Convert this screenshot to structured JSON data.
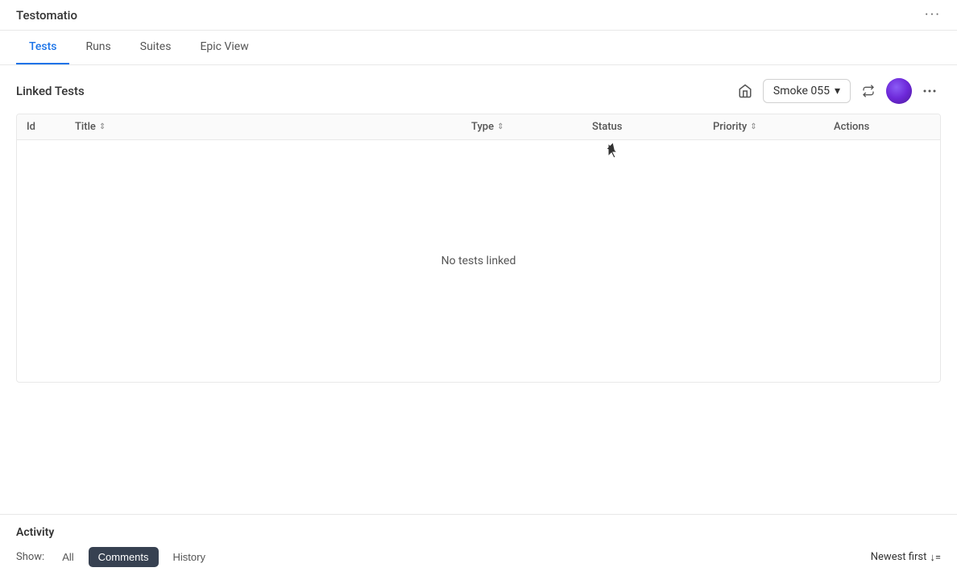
{
  "app": {
    "title": "Testomatio",
    "more_dots": "···"
  },
  "nav": {
    "tabs": [
      {
        "id": "tests",
        "label": "Tests",
        "active": true
      },
      {
        "id": "runs",
        "label": "Runs",
        "active": false
      },
      {
        "id": "suites",
        "label": "Suites",
        "active": false
      },
      {
        "id": "epic-view",
        "label": "Epic View",
        "active": false
      }
    ]
  },
  "content": {
    "title": "Linked Tests",
    "suite_selector": {
      "value": "Smoke 055",
      "chevron": "▾"
    },
    "empty_message": "No tests linked"
  },
  "table": {
    "columns": [
      {
        "id": "id",
        "label": "Id",
        "sortable": false
      },
      {
        "id": "title",
        "label": "Title",
        "sort_icon": "⇕"
      },
      {
        "id": "type",
        "label": "Type",
        "sort_icon": "⇕"
      },
      {
        "id": "status",
        "label": "Status",
        "sortable": false
      },
      {
        "id": "priority",
        "label": "Priority",
        "sort_icon": "⇕"
      },
      {
        "id": "actions",
        "label": "Actions",
        "sortable": false
      }
    ]
  },
  "activity": {
    "title": "Activity",
    "show_label": "Show:",
    "filters": [
      {
        "id": "all",
        "label": "All",
        "active": false
      },
      {
        "id": "comments",
        "label": "Comments",
        "active": true
      },
      {
        "id": "history",
        "label": "History",
        "active": false
      }
    ],
    "sort": {
      "label": "Newest first",
      "icon": "↓="
    }
  },
  "icons": {
    "home": "⌂",
    "sync": "⇄",
    "more": "···"
  }
}
